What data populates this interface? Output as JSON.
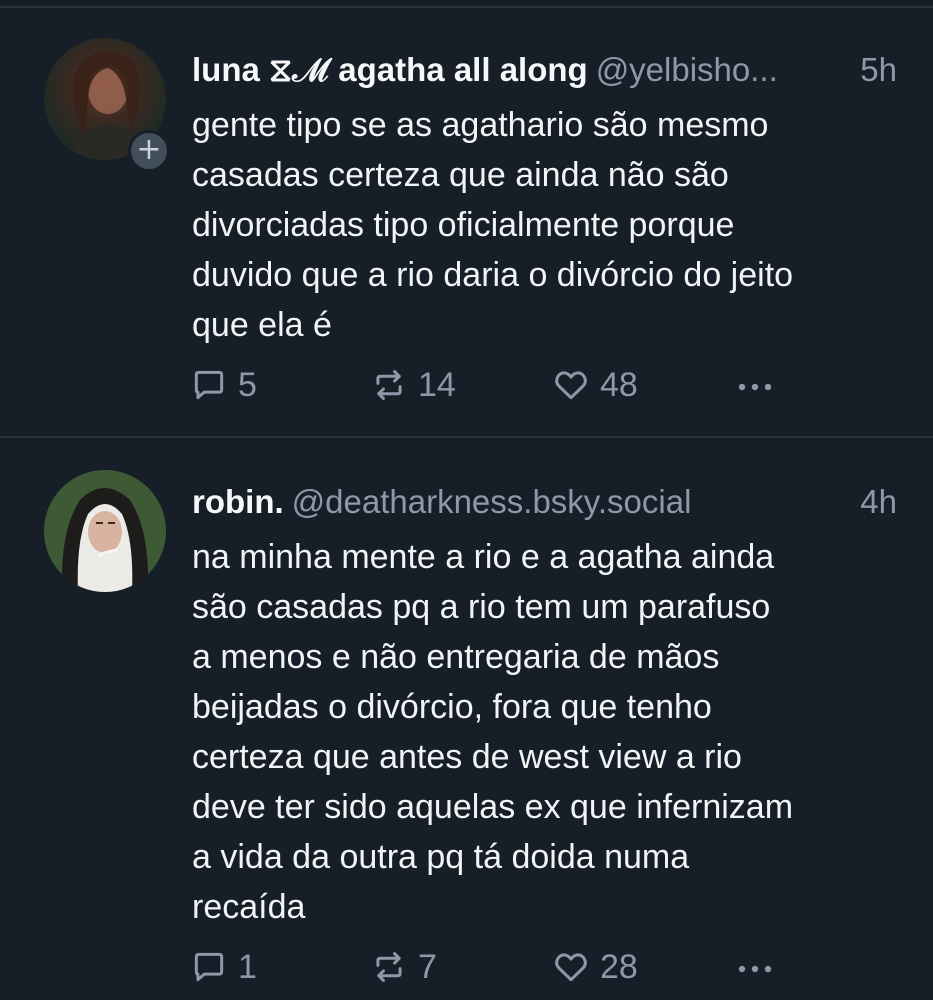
{
  "posts": [
    {
      "display_name": "luna ⧖ℳ agatha all along",
      "handle": "@yelbisho...",
      "time": "5h",
      "text": "gente tipo se as agathario são mesmo\ncasadas certeza que ainda não são\ndivorciadas tipo oficialmente porque\nduvido que a rio daria o divórcio do jeito\nque ela é",
      "replies": "5",
      "reposts": "14",
      "likes": "48",
      "follow_badge": "+"
    },
    {
      "display_name": "robin.",
      "handle": "@deatharkness.bsky.social",
      "time": "4h",
      "text": "na minha mente a rio e a agatha ainda\nsão casadas pq a rio tem um parafuso\na menos e não entregaria de mãos\nbeijadas o divórcio, fora que tenho\ncerteza que antes de west view a rio\ndeve ter sido aquelas ex que infernizam\na vida da outra pq tá doida numa\nrecaída",
      "replies": "1",
      "reposts": "7",
      "likes": "28"
    }
  ],
  "icons": {
    "reply": "reply-icon",
    "repost": "repost-icon",
    "like": "heart-icon",
    "more": "more-icon"
  },
  "colors": {
    "background": "#161e27",
    "text": "#f1f3f5",
    "muted": "#8c99a8",
    "divider": "#2a3440"
  }
}
